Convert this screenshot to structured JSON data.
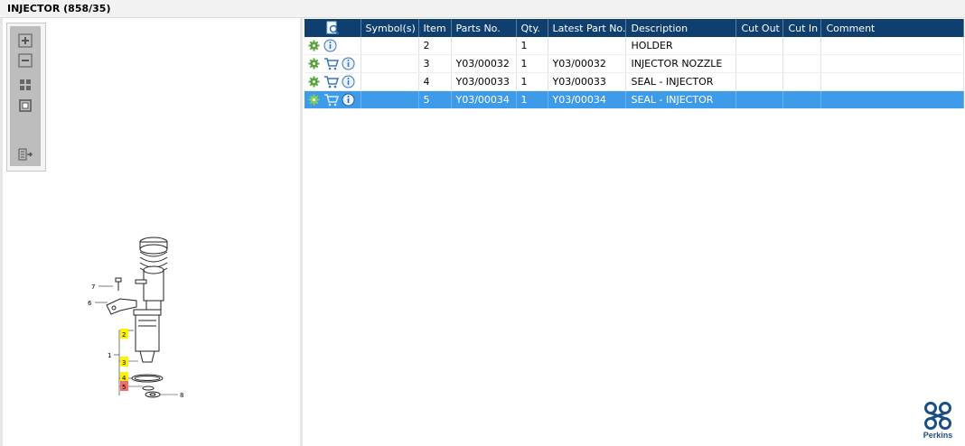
{
  "window": {
    "title": "INJECTOR (858/35)"
  },
  "toolbox": {
    "icons": [
      "zoom-in-icon",
      "zoom-out-icon",
      "fit-page-icon",
      "actual-size-icon",
      "export-icon"
    ]
  },
  "table": {
    "columns": [
      "Symbol(s)",
      "Item",
      "Parts No.",
      "Qty.",
      "Latest Part No.",
      "Description",
      "Cut Out",
      "Cut In",
      "Comment"
    ],
    "rows": [
      {
        "symbols": "",
        "item": "2",
        "parts_no": "",
        "qty": "1",
        "latest_part_no": "",
        "description": "HOLDER",
        "cut_out": "",
        "cut_in": "",
        "comment": ""
      },
      {
        "symbols": "",
        "item": "3",
        "parts_no": "Y03/00032",
        "qty": "1",
        "latest_part_no": "Y03/00032",
        "description": "INJECTOR NOZZLE",
        "cut_out": "",
        "cut_in": "",
        "comment": ""
      },
      {
        "symbols": "",
        "item": "4",
        "parts_no": "Y03/00033",
        "qty": "1",
        "latest_part_no": "Y03/00033",
        "description": "SEAL - INJECTOR",
        "cut_out": "",
        "cut_in": "",
        "comment": ""
      },
      {
        "symbols": "",
        "item": "5",
        "parts_no": "Y03/00034",
        "qty": "1",
        "latest_part_no": "Y03/00034",
        "description": "SEAL - INJECTOR",
        "cut_out": "",
        "cut_in": "",
        "comment": ""
      }
    ],
    "selected_row": 3
  },
  "diagram": {
    "callouts": [
      "7",
      "6",
      "2",
      "1",
      "3",
      "4",
      "5",
      "8"
    ]
  },
  "brand": {
    "name": "Perkins"
  },
  "colors": {
    "header": "#0e3f6f",
    "selection": "#3d9be9",
    "highlight_yellow": "#fff200",
    "highlight_red": "#ef6f6f"
  }
}
